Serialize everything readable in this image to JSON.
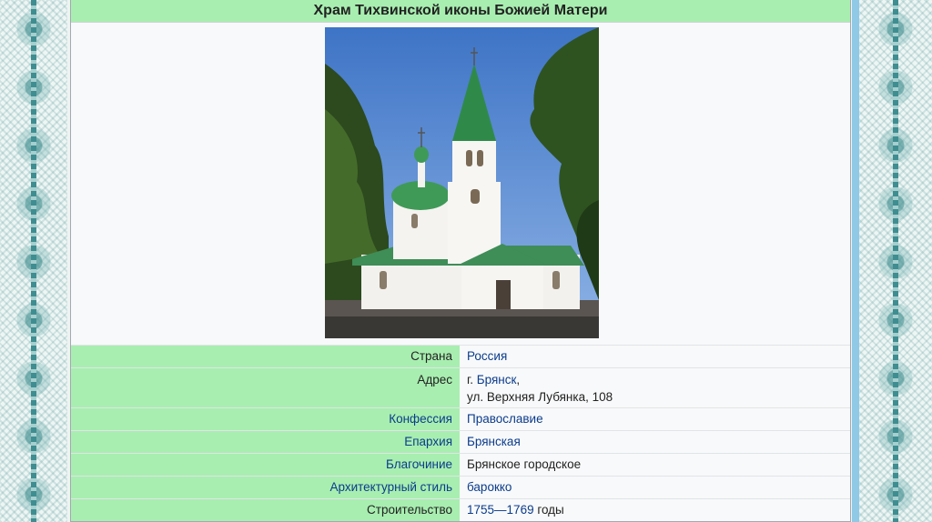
{
  "title": "Храм Тихвинской иконы Божией Матери",
  "photo": {
    "icon": "church-photo"
  },
  "rows": {
    "country": {
      "label": "Страна",
      "value": "Россия"
    },
    "address": {
      "label": "Адрес",
      "value_prefix": "г. ",
      "value_link": "Брянск",
      "value_suffix": ",",
      "value_line2": "ул. Верхняя Лубянка, 108"
    },
    "confession": {
      "label": "Конфессия",
      "value": "Православие"
    },
    "eparchy": {
      "label": "Епархия",
      "value": "Брянская"
    },
    "deanery": {
      "label": "Благочиние",
      "value": "Брянское городское"
    },
    "style": {
      "label": "Архитектурный стиль",
      "value": "барокко"
    },
    "construction": {
      "label": "Строительство",
      "value_start": "1755",
      "value_dash": "—",
      "value_end": "1769",
      "value_suffix": " годы"
    }
  },
  "colors": {
    "header": "#a8eeb0",
    "link": "#0b3c8c",
    "ornament": "#3d8a8c"
  }
}
